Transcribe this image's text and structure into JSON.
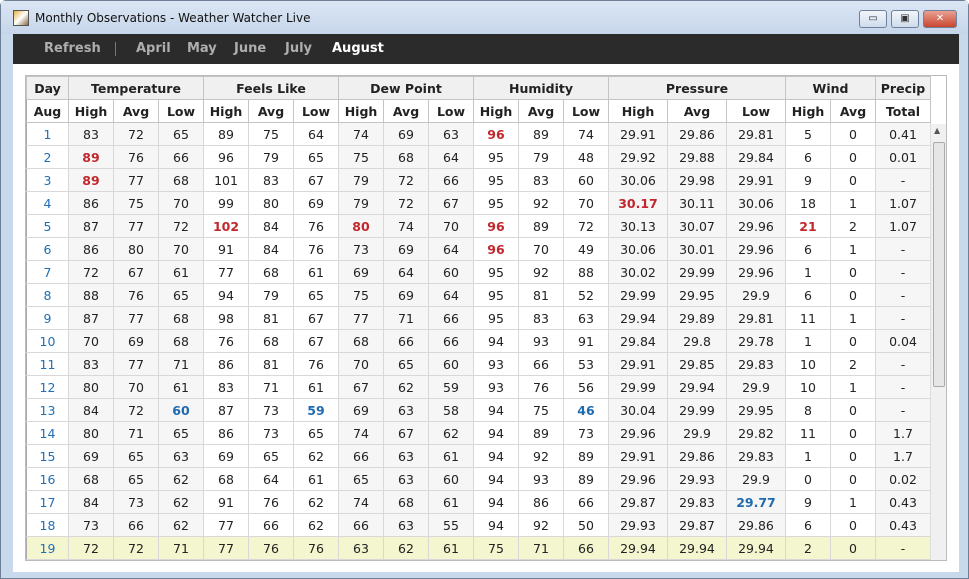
{
  "window": {
    "title": "Monthly Observations - Weather Watcher Live",
    "minimize": "▭",
    "maximize": "▣",
    "close": "✕"
  },
  "toolbar": {
    "refresh": "Refresh",
    "months": [
      "April",
      "May",
      "June",
      "July",
      "August"
    ],
    "active_month": "August"
  },
  "table": {
    "groups": [
      {
        "label": "Day",
        "span": 1
      },
      {
        "label": "Temperature",
        "span": 3
      },
      {
        "label": "Feels Like",
        "span": 3
      },
      {
        "label": "Dew Point",
        "span": 3
      },
      {
        "label": "Humidity",
        "span": 3
      },
      {
        "label": "Pressure",
        "span": 3
      },
      {
        "label": "Wind",
        "span": 2
      },
      {
        "label": "Precip",
        "span": 1
      }
    ],
    "subheaders": [
      "Aug",
      "High",
      "Avg",
      "Low",
      "High",
      "Avg",
      "Low",
      "High",
      "Avg",
      "Low",
      "High",
      "Avg",
      "Low",
      "High",
      "Avg",
      "Low",
      "High",
      "Avg",
      "Total"
    ],
    "rows": [
      [
        "1",
        "83",
        "72",
        "65",
        "89",
        "75",
        "64",
        "74",
        "69",
        "63",
        "96",
        "89",
        "74",
        "29.91",
        "29.86",
        "29.81",
        "5",
        "0",
        "0.41"
      ],
      [
        "2",
        "89",
        "76",
        "66",
        "96",
        "79",
        "65",
        "75",
        "68",
        "64",
        "95",
        "79",
        "48",
        "29.92",
        "29.88",
        "29.84",
        "6",
        "0",
        "0.01"
      ],
      [
        "3",
        "89",
        "77",
        "68",
        "101",
        "83",
        "67",
        "79",
        "72",
        "66",
        "95",
        "83",
        "60",
        "30.06",
        "29.98",
        "29.91",
        "9",
        "0",
        "-"
      ],
      [
        "4",
        "86",
        "75",
        "70",
        "99",
        "80",
        "69",
        "79",
        "72",
        "67",
        "95",
        "92",
        "70",
        "30.17",
        "30.11",
        "30.06",
        "18",
        "1",
        "1.07"
      ],
      [
        "5",
        "87",
        "77",
        "72",
        "102",
        "84",
        "76",
        "80",
        "74",
        "70",
        "96",
        "89",
        "72",
        "30.13",
        "30.07",
        "29.96",
        "21",
        "2",
        "1.07"
      ],
      [
        "6",
        "86",
        "80",
        "70",
        "91",
        "84",
        "76",
        "73",
        "69",
        "64",
        "96",
        "70",
        "49",
        "30.06",
        "30.01",
        "29.96",
        "6",
        "1",
        "-"
      ],
      [
        "7",
        "72",
        "67",
        "61",
        "77",
        "68",
        "61",
        "69",
        "64",
        "60",
        "95",
        "92",
        "88",
        "30.02",
        "29.99",
        "29.96",
        "1",
        "0",
        "-"
      ],
      [
        "8",
        "88",
        "76",
        "65",
        "94",
        "79",
        "65",
        "75",
        "69",
        "64",
        "95",
        "81",
        "52",
        "29.99",
        "29.95",
        "29.9",
        "6",
        "0",
        "-"
      ],
      [
        "9",
        "87",
        "77",
        "68",
        "98",
        "81",
        "67",
        "77",
        "71",
        "66",
        "95",
        "83",
        "63",
        "29.94",
        "29.89",
        "29.81",
        "11",
        "1",
        "-"
      ],
      [
        "10",
        "70",
        "69",
        "68",
        "76",
        "68",
        "67",
        "68",
        "66",
        "66",
        "94",
        "93",
        "91",
        "29.84",
        "29.8",
        "29.78",
        "1",
        "0",
        "0.04"
      ],
      [
        "11",
        "83",
        "77",
        "71",
        "86",
        "81",
        "76",
        "70",
        "65",
        "60",
        "93",
        "66",
        "53",
        "29.91",
        "29.85",
        "29.83",
        "10",
        "2",
        "-"
      ],
      [
        "12",
        "80",
        "70",
        "61",
        "83",
        "71",
        "61",
        "67",
        "62",
        "59",
        "93",
        "76",
        "56",
        "29.99",
        "29.94",
        "29.9",
        "10",
        "1",
        "-"
      ],
      [
        "13",
        "84",
        "72",
        "60",
        "87",
        "73",
        "59",
        "69",
        "63",
        "58",
        "94",
        "75",
        "46",
        "30.04",
        "29.99",
        "29.95",
        "8",
        "0",
        "-"
      ],
      [
        "14",
        "80",
        "71",
        "65",
        "86",
        "73",
        "65",
        "74",
        "67",
        "62",
        "94",
        "89",
        "73",
        "29.96",
        "29.9",
        "29.82",
        "11",
        "0",
        "1.7"
      ],
      [
        "15",
        "69",
        "65",
        "63",
        "69",
        "65",
        "62",
        "66",
        "63",
        "61",
        "94",
        "92",
        "89",
        "29.91",
        "29.86",
        "29.83",
        "1",
        "0",
        "1.7"
      ],
      [
        "16",
        "68",
        "65",
        "62",
        "68",
        "64",
        "61",
        "65",
        "63",
        "60",
        "94",
        "93",
        "89",
        "29.96",
        "29.93",
        "29.9",
        "0",
        "0",
        "0.02"
      ],
      [
        "17",
        "84",
        "73",
        "62",
        "91",
        "76",
        "62",
        "74",
        "68",
        "61",
        "94",
        "86",
        "66",
        "29.87",
        "29.83",
        "29.77",
        "9",
        "1",
        "0.43"
      ],
      [
        "18",
        "73",
        "66",
        "62",
        "77",
        "66",
        "62",
        "66",
        "63",
        "55",
        "94",
        "92",
        "50",
        "29.93",
        "29.87",
        "29.86",
        "6",
        "0",
        "0.43"
      ],
      [
        "19",
        "72",
        "72",
        "71",
        "77",
        "76",
        "76",
        "63",
        "62",
        "61",
        "75",
        "71",
        "66",
        "29.94",
        "29.94",
        "29.94",
        "2",
        "0",
        "-"
      ]
    ],
    "current_row": 18,
    "highlights": [
      {
        "row": 0,
        "col": 10,
        "type": "max"
      },
      {
        "row": 1,
        "col": 1,
        "type": "max"
      },
      {
        "row": 2,
        "col": 1,
        "type": "max"
      },
      {
        "row": 3,
        "col": 13,
        "type": "max"
      },
      {
        "row": 4,
        "col": 4,
        "type": "max"
      },
      {
        "row": 4,
        "col": 7,
        "type": "max"
      },
      {
        "row": 4,
        "col": 10,
        "type": "max"
      },
      {
        "row": 4,
        "col": 16,
        "type": "max"
      },
      {
        "row": 5,
        "col": 10,
        "type": "max"
      },
      {
        "row": 12,
        "col": 3,
        "type": "min"
      },
      {
        "row": 12,
        "col": 6,
        "type": "min"
      },
      {
        "row": 12,
        "col": 12,
        "type": "min"
      },
      {
        "row": 16,
        "col": 15,
        "type": "min"
      }
    ],
    "colors": {
      "max": "#c1272d",
      "min": "#1e6bb0",
      "current_row": "#f4f6cf"
    }
  }
}
